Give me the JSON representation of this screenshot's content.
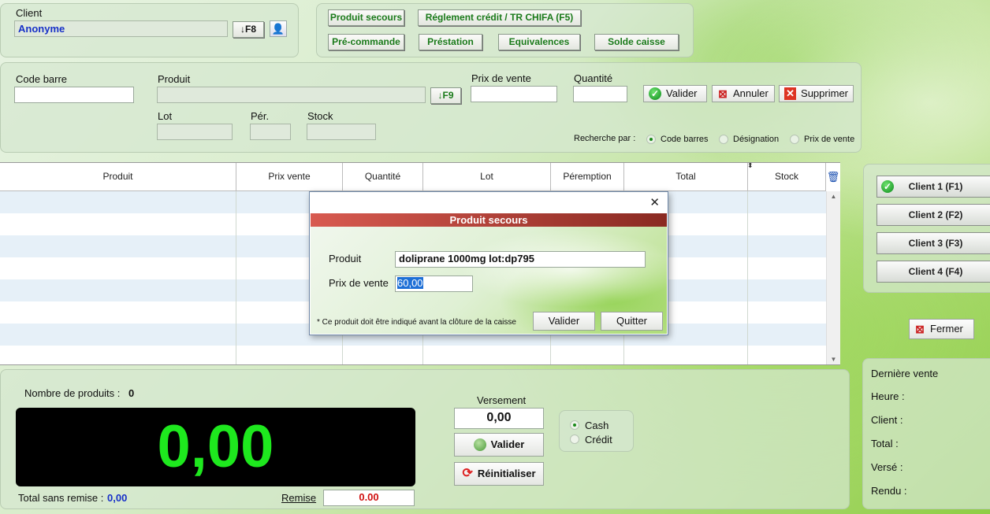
{
  "client": {
    "label": "Client",
    "value": "Anonyme",
    "f8": "↓F8"
  },
  "top_buttons": [
    "Produit secours",
    "Réglement crédit / TR CHIFA (F5)",
    "Pré-commande",
    "Préstation",
    "Equivalences",
    "Solde caisse"
  ],
  "entry": {
    "code_barre": "Code barre",
    "produit": "Produit",
    "f9": "↓F9",
    "prix_vente": "Prix de vente",
    "quantite": "Quantité",
    "lot": "Lot",
    "per": "Pér.",
    "stock": "Stock",
    "valider": "Valider",
    "annuler": "Annuler",
    "supprimer": "Supprimer",
    "recherche_label": "Recherche par :",
    "recherche_options": [
      "Code barres",
      "Désignation",
      "Prix de vente"
    ]
  },
  "table": {
    "headers": [
      "Produit",
      "Prix vente",
      "Quantité",
      "Lot",
      "Péremption",
      "Total",
      "Stock"
    ]
  },
  "side": {
    "clients": [
      "Client 1 (F1)",
      "Client 2 (F2)",
      "Client 3 (F3)",
      "Client 4 (F4)"
    ],
    "fermer": "Fermer"
  },
  "bottom": {
    "nb_label": "Nombre de produits :",
    "nb_value": "0",
    "display": "0,00",
    "total_sans_remise_label": "Total sans remise :",
    "total_sans_remise": "0,00",
    "remise_label": "Remise",
    "remise_value": "0.00",
    "versement_label": "Versement",
    "versement_value": "0,00",
    "valider": "Valider",
    "reinit": "Réinitialiser",
    "cash": "Cash",
    "credit": "Crédit"
  },
  "derniere": {
    "title": "Dernière vente",
    "heure": "Heure :",
    "client": "Client :",
    "total": "Total :",
    "verse": "Versé :",
    "rendu": "Rendu :"
  },
  "dialog": {
    "title": "Produit secours",
    "close": "✕",
    "produit_label": "Produit",
    "produit_value": "doliprane 1000mg   lot:dp795",
    "prix_label": "Prix de vente",
    "prix_value": "60,00",
    "note": "* Ce produit doit être indiqué avant la clôture de la caisse",
    "valider": "Valider",
    "quitter": "Quitter"
  }
}
